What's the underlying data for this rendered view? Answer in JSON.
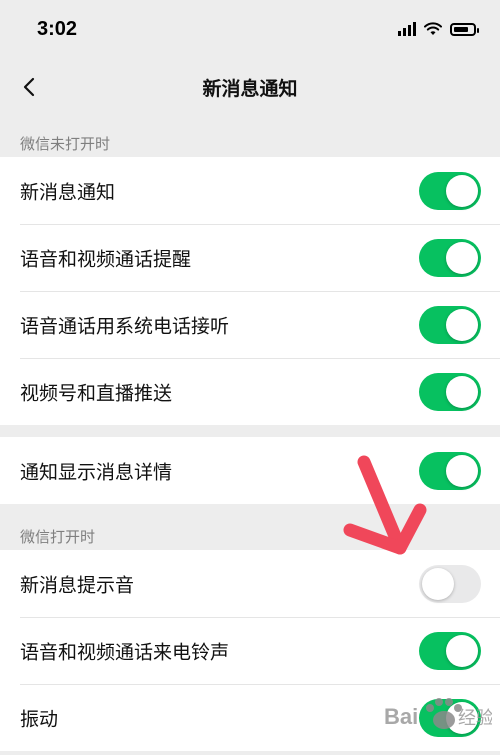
{
  "status_bar": {
    "time": "3:02",
    "battery_level": 0.75
  },
  "nav": {
    "title": "新消息通知",
    "back_icon": "chevron-left-icon"
  },
  "sections": {
    "closed": {
      "title": "微信未打开时"
    },
    "open": {
      "title": "微信打开时"
    }
  },
  "group1": [
    {
      "label": "新消息通知",
      "on": true
    },
    {
      "label": "语音和视频通话提醒",
      "on": true
    },
    {
      "label": "语音通话用系统电话接听",
      "on": true
    },
    {
      "label": "视频号和直播推送",
      "on": true
    }
  ],
  "group2": [
    {
      "label": "通知显示消息详情",
      "on": true
    }
  ],
  "group3": [
    {
      "label": "新消息提示音",
      "on": false
    },
    {
      "label": "语音和视频通话来电铃声",
      "on": true
    },
    {
      "label": "振动",
      "on": true
    }
  ],
  "colors": {
    "toggle_on": "#07c160",
    "toggle_off": "#e9e9ea",
    "background": "#ededed",
    "arrow": "#f0475a"
  },
  "watermark": {
    "text": "Bai经验"
  }
}
